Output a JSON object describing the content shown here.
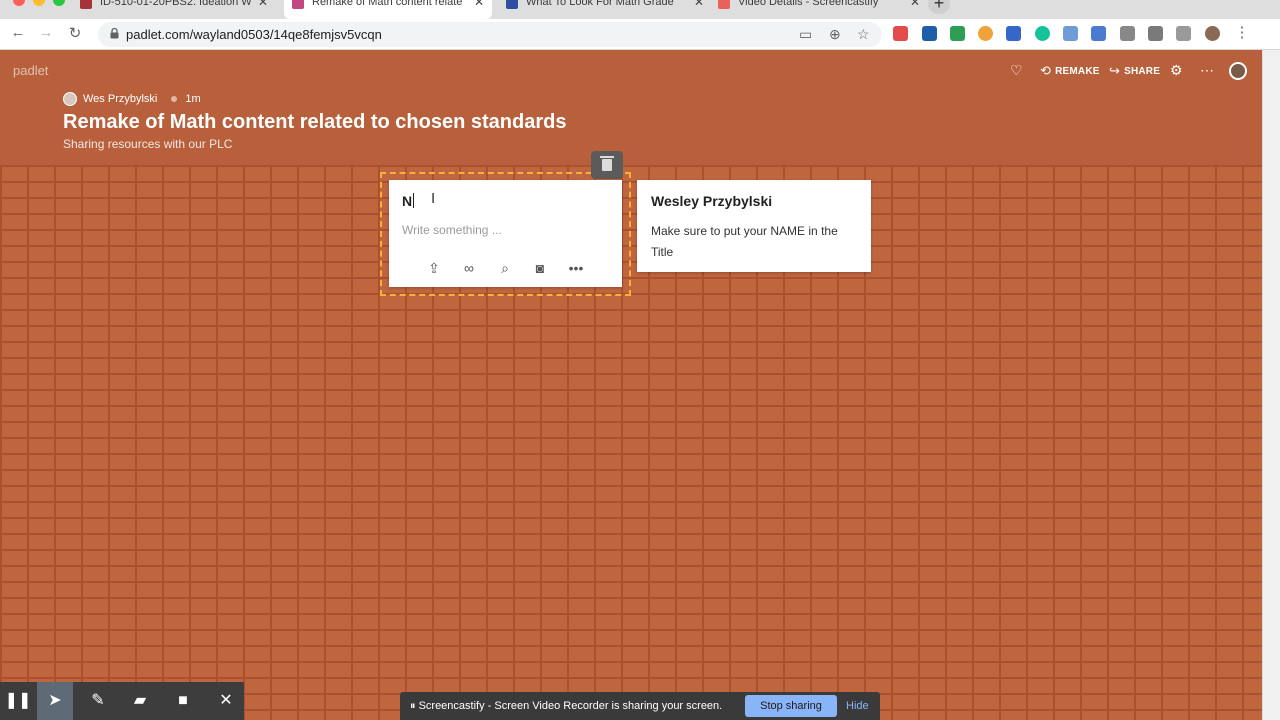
{
  "browser": {
    "tabs": [
      {
        "title": "ID-510-01-20PBS2: Ideation W",
        "active": false
      },
      {
        "title": "Remake of Math content relate",
        "active": true
      },
      {
        "title": "What To Look For Math Grade",
        "active": false
      },
      {
        "title": "Video Details - Screencastify",
        "active": false
      }
    ],
    "new_tab": "+",
    "url": "padlet.com/wayland0503/14qe8femjsv5vcqn"
  },
  "padlet": {
    "brand": "padlet",
    "actions": {
      "remake": "REMAKE",
      "share": "SHARE"
    },
    "author": "Wes Przybylski",
    "time": "1m",
    "title": "Remake of Math content related to chosen standards",
    "subtitle": "Sharing resources with our PLC"
  },
  "editing_post": {
    "title_value": "N",
    "body_placeholder": "Write something ..."
  },
  "post": {
    "title": "Wesley Przybylski",
    "body": "Make sure to put your NAME in the Title"
  },
  "screencastify": {
    "message": "Screencastify - Screen Video Recorder is sharing your screen.",
    "stop": "Stop sharing",
    "hide": "Hide"
  }
}
